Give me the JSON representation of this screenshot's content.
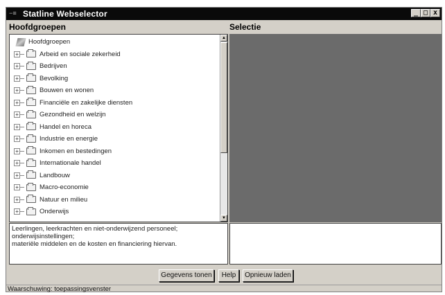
{
  "window": {
    "title": "Statline Webselector",
    "icon_text": "−≡",
    "controls": {
      "minimize": "_",
      "maximize": "□",
      "close": "x"
    }
  },
  "panels": {
    "left_header": "Hoofdgroepen",
    "right_header": "Selectie"
  },
  "tree": {
    "root_label": "Hoofdgroepen",
    "items": [
      {
        "label": "Arbeid en sociale zekerheid",
        "expander": "+"
      },
      {
        "label": "Bedrijven",
        "expander": "+"
      },
      {
        "label": "Bevolking",
        "expander": "+"
      },
      {
        "label": "Bouwen en wonen",
        "expander": "+"
      },
      {
        "label": "Financiële en zakelijke diensten",
        "expander": "+"
      },
      {
        "label": "Gezondheid en welzijn",
        "expander": "+"
      },
      {
        "label": "Handel en horeca",
        "expander": "+"
      },
      {
        "label": "Industrie en energie",
        "expander": "+"
      },
      {
        "label": "Inkomen en bestedingen",
        "expander": "+"
      },
      {
        "label": "Internationale handel",
        "expander": "+"
      },
      {
        "label": "Landbouw",
        "expander": "+"
      },
      {
        "label": "Macro-economie",
        "expander": "+"
      },
      {
        "label": "Natuur en milieu",
        "expander": "+"
      },
      {
        "label": "Onderwijs",
        "expander": "+"
      }
    ],
    "scroll_up": "▲",
    "scroll_down": "▼"
  },
  "description": {
    "line1": "Leerlingen, leerkrachten en niet-onderwijzend personeel;",
    "line2": "onderwijsinstellingen;",
    "line3": "materiële middelen en de  kosten en financiering hiervan."
  },
  "buttons": {
    "show_data": "Gegevens tonen",
    "help": "Help",
    "reload": "Opnieuw laden"
  },
  "status": {
    "text": "Waarschuwing: toepassingsvenster"
  },
  "colors": {
    "titlebar": "#0a0a0a",
    "window_bg": "#d4d0c8",
    "selectie_bg": "#6b6b6b"
  }
}
